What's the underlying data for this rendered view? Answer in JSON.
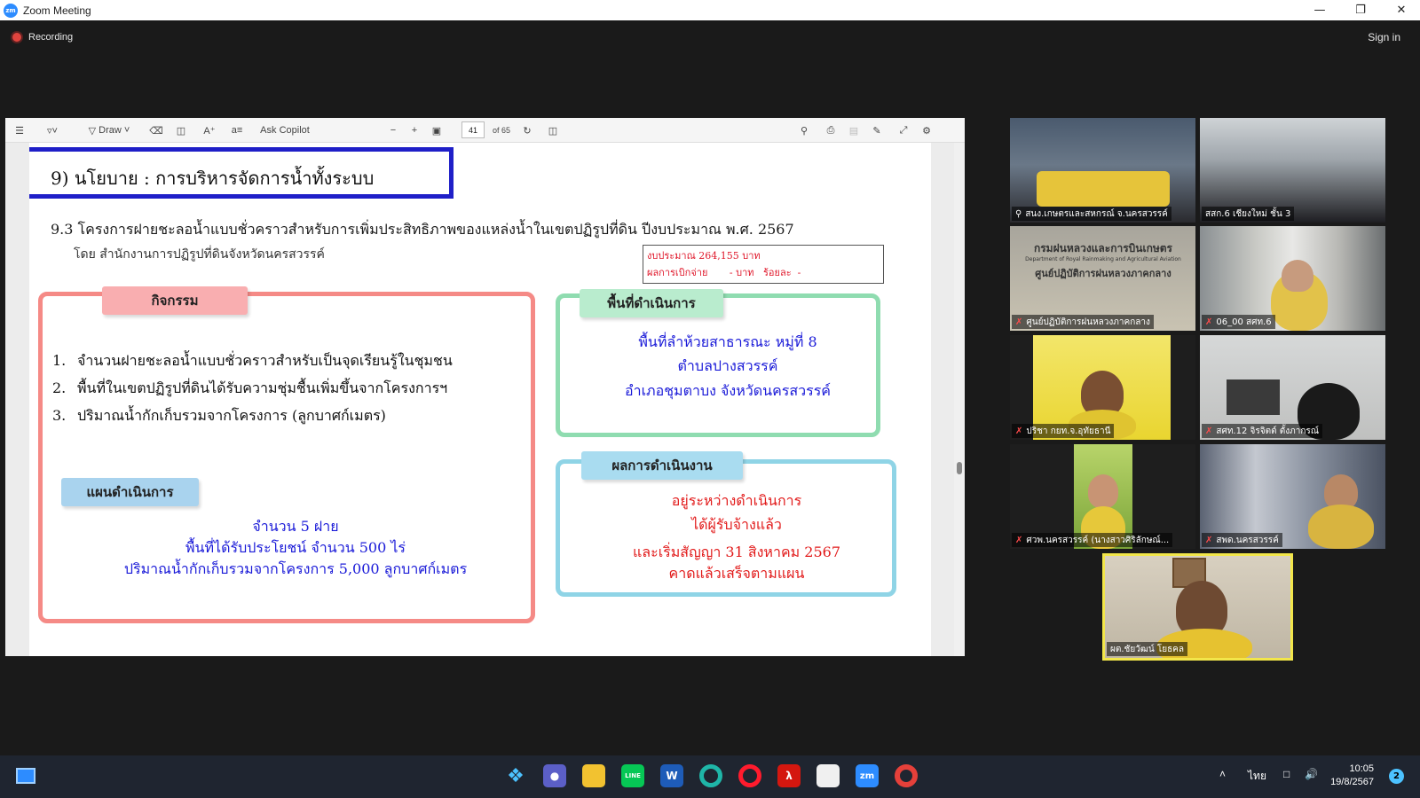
{
  "window": {
    "title": "Zoom Meeting"
  },
  "topbar": {
    "recording_label": "Recording",
    "signin_label": "Sign in"
  },
  "pdf_toolbar": {
    "draw_label": "Draw",
    "copilot_label": "Ask Copilot",
    "page_current": "41",
    "page_total": "of 65"
  },
  "slide": {
    "heading": "9) นโยบาย : การบริหารจัดการน้ำทั้งระบบ",
    "subtitle": "9.3 โครงการฝายชะลอน้ำแบบชั่วคราวสำหรับการเพิ่มประสิทธิภาพของแหล่งน้ำในเขตปฏิรูปที่ดิน ปีงบประมาณ พ.ศ. 2567",
    "byline": "โดย สำนักงานการปฏิรูปที่ดินจังหวัดนครสวรรค์",
    "budget_line1": "งบประมาณ 264,155 บาท",
    "budget_line2": "ผลการเบิกจ่าย       - บาท   ร้อยละ  -",
    "activity_tag": "กิจกรรม",
    "activities": [
      {
        "num": "1.",
        "text": "จำนวนฝายชะลอน้ำแบบชั่วคราวสำหรับเป็นจุดเรียนรู้ในชุมชน"
      },
      {
        "num": "2.",
        "text": "พื้นที่ในเขตปฏิรูปที่ดินได้รับความชุ่มชื้นเพิ่มขึ้นจากโครงการฯ"
      },
      {
        "num": "3.",
        "text": "ปริมาณน้ำกักเก็บรวมจากโครงการ (ลูกบาศก์เมตร)"
      }
    ],
    "plan_tag": "แผนดำเนินการ",
    "plan_lines": [
      "จำนวน 5 ฝาย",
      "พื้นที่ได้รับประโยชน์ จำนวน 500 ไร่",
      "ปริมาณน้ำกักเก็บรวมจากโครงการ 5,000 ลูกบาศก์เมตร"
    ],
    "area_tag": "พื้นที่ดำเนินการ",
    "area_lines": [
      "พื้นที่ลำห้วยสาธารณะ หมู่ที่ 8",
      "ตำบลปางสวรรค์",
      "อำเภอชุมตาบง  จังหวัดนครสวรรค์"
    ],
    "result_tag": "ผลการดำเนินงาน",
    "result_lines": [
      "อยู่ระหว่างดำเนินการ",
      "ได้ผู้รับจ้างแล้ว",
      "และเริ่มสัญญา 31 สิงหาคม 2567",
      "คาดแล้วเสร็จตามแผน"
    ]
  },
  "participants": [
    {
      "name": "สนง.เกษตรและสหกรณ์ จ.นครสวรรค์",
      "icon": "pin-icon"
    },
    {
      "name": "สสก.6 เชียงใหม่ ชั้น 3",
      "icon": ""
    },
    {
      "name": "ศูนย์ปฏิบัติการฝนหลวงภาคกลาง",
      "icon": "mic-muted-icon",
      "sign_text": "กรมฝนหลวงและการบินเกษตร",
      "sign_sub": "Department of Royal Rainmaking and Agricultural Aviation",
      "sign_text2": "ศูนย์ปฏิบัติการฝนหลวงภาคกลาง"
    },
    {
      "name": "06_00 สศท.6",
      "icon": "mic-muted-icon"
    },
    {
      "name": "ปริชา กยท.จ.อุทัยธานี",
      "icon": "mic-muted-icon"
    },
    {
      "name": "สศท.12 จิรจิตต์ ตั้งภากรณ์",
      "icon": "mic-muted-icon"
    },
    {
      "name": "ศวพ.นครสวรรค์ (นางสาวศิริลักษณ์...",
      "icon": "mic-muted-icon"
    },
    {
      "name": "สพด.นครสวรรค์",
      "icon": "mic-muted-icon"
    },
    {
      "name": "ผต.ชัยวัฒน์ โยธคล",
      "icon": ""
    }
  ],
  "taskbar": {
    "language": "ไทย",
    "time": "10:05",
    "date": "19/8/2567",
    "notifications": "2"
  },
  "colors": {
    "activity_border": "#f58a86",
    "area_border": "#8fdcb0",
    "result_border": "#8fd4e6",
    "title_border": "#1f1fc8",
    "active_speaker": "#f2e64a"
  }
}
